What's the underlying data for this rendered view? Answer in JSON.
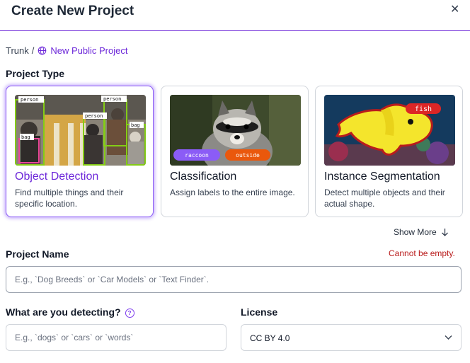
{
  "dialog": {
    "title": "Create New Project"
  },
  "breadcrumb": {
    "root": "Trunk",
    "separator": "/",
    "current": "New Public Project"
  },
  "project_type": {
    "label": "Project Type",
    "cards": [
      {
        "title": "Object Detection",
        "description": "Find multiple things and their specific location.",
        "selected": true,
        "image_labels": [
          "person",
          "person",
          "person",
          "bag",
          "bag"
        ]
      },
      {
        "title": "Classification",
        "description": "Assign labels to the entire image.",
        "selected": false,
        "image_labels": [
          "raccoon",
          "outside"
        ]
      },
      {
        "title": "Instance Segmentation",
        "description": "Detect multiple objects and their actual shape.",
        "selected": false,
        "image_labels": [
          "fish"
        ]
      }
    ],
    "show_more": "Show More"
  },
  "project_name": {
    "label": "Project Name",
    "error": "Cannot be empty.",
    "value": "",
    "placeholder": "E.g., `Dog Breeds` or `Car Models` or `Text Finder`."
  },
  "detecting": {
    "label": "What are you detecting?",
    "value": "",
    "placeholder": "E.g., `dogs` or `cars` or `words`"
  },
  "license": {
    "label": "License",
    "value": "CC BY 4.0"
  },
  "colors": {
    "accent": "#6d28d9",
    "selected_border": "#8b5cf6",
    "error": "#b91c1c",
    "detection_box": "#84cc16",
    "bag_box": "#ec4899",
    "tag_purple": "#8b5cf6",
    "tag_orange": "#ea580c",
    "tag_red": "#dc2626"
  },
  "icons": [
    "close-icon",
    "globe-icon",
    "arrow-down-icon",
    "help-icon",
    "chevron-down-icon"
  ]
}
